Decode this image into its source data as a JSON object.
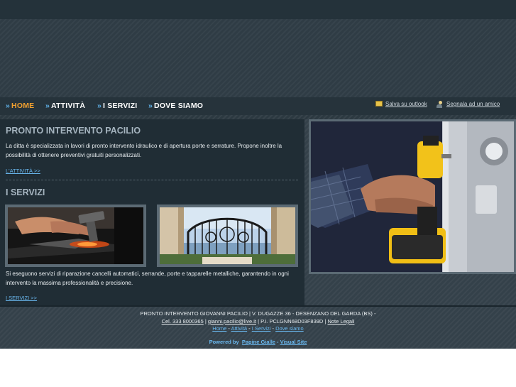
{
  "nav": {
    "items": [
      {
        "label": "HOME"
      },
      {
        "label": "ATTIVITÀ"
      },
      {
        "label": "I SERVIZI"
      },
      {
        "label": "DOVE SIAMO"
      }
    ],
    "arrow": "»"
  },
  "tools": {
    "save_outlook": "Salva su outlook",
    "tell_friend": "Segnala ad un amico"
  },
  "intro": {
    "title": "PRONTO INTERVENTO PACILIO",
    "text": "La ditta è specializzata in lavori di pronto intervento idraulico e di apertura porte e serrature. Propone inoltre la possibilità di ottenere preventivi gratuiti personalizzati.",
    "link": "L'ATTIVITÀ >>"
  },
  "services": {
    "title": "I SERVIZI",
    "text": "Si eseguono servizi di riparazione cancelli automatici, serrande, porte e tapparelle metalliche, garantendo in ogni intervento la massima professionalità e precisione.",
    "link": "I SERVIZI >>"
  },
  "footer": {
    "line1": "PRONTO INTERVENTO GIOVANNI PACILIO | V. DUGAZZE 36 - DESENZANO DEL GARDA (BS) -",
    "phone": "Cel. 333 8000365",
    "sep1": " | ",
    "email": "gianni.pacilio@live.it",
    "piva": " | P.I. PCLGNN68D03F839D | ",
    "legal": "Note Legali",
    "nav": [
      "Home",
      "Attività",
      "I Servizi",
      "Dove siamo"
    ],
    "nav_sep": " - ",
    "powered_label": "Powered by",
    "pagine": "Pagine Gialle",
    "dash": " - ",
    "visual": "Visual Site"
  },
  "colors": {
    "accent_active": "#f0a030",
    "link": "#69b7ee",
    "panel": "#202d35"
  },
  "icons": [
    "outlook-icon",
    "friend-icon",
    "drill-photo",
    "hammer-anvil-photo",
    "gate-photo"
  ]
}
